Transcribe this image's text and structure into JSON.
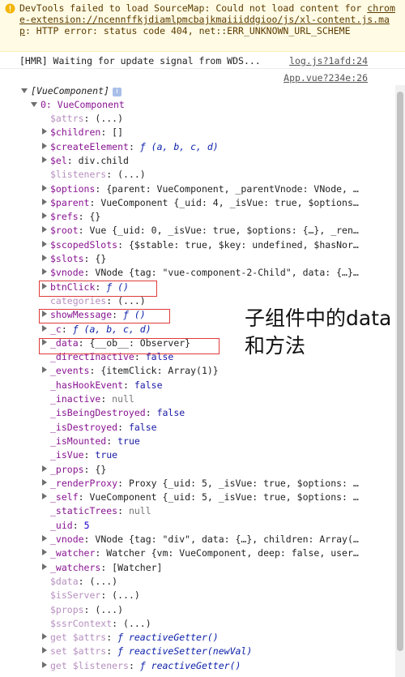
{
  "warning": {
    "icon": "warning-triangle-icon",
    "prefix": "DevTools failed to load SourceMap: Could not load content for ",
    "url": "chrome-extension://ncennffkjdiamlpmcbajkmaiiiddgioo/js/xl-content.js.map",
    "suffix": ": HTTP error: status code 404, net::ERR_UNKNOWN_URL_SCHEME"
  },
  "hmr": {
    "message": "[HMR] Waiting for update signal from WDS...",
    "source": "log.js?1afd:24"
  },
  "log_source": "App.vue?234e:26",
  "tree": {
    "root_label": "[VueComponent]",
    "item_label": "0: VueComponent",
    "props": [
      {
        "key": "$attrs",
        "value": "(...)",
        "expandable": false
      },
      {
        "key": "$children",
        "value": "[]",
        "expandable": true
      },
      {
        "key": "$createElement",
        "value": "ƒ (a, b, c, d)",
        "expandable": true
      },
      {
        "key": "$el",
        "value": "div.child",
        "expandable": true
      },
      {
        "key": "$listeners",
        "value": "(...)",
        "expandable": false
      },
      {
        "key": "$options",
        "value": "{parent: VueComponent, _parentVnode: VNode, …",
        "expandable": true
      },
      {
        "key": "$parent",
        "value": "VueComponent {_uid: 4, _isVue: true, $options…",
        "expandable": true
      },
      {
        "key": "$refs",
        "value": "{}",
        "expandable": true
      },
      {
        "key": "$root",
        "value": "Vue {_uid: 0, _isVue: true, $options: {…}, _ren…",
        "expandable": true
      },
      {
        "key": "$scopedSlots",
        "value": "{$stable: true, $key: undefined, $hasNor…",
        "expandable": true
      },
      {
        "key": "$slots",
        "value": "{}",
        "expandable": true
      },
      {
        "key": "$vnode",
        "value": "VNode {tag: \"vue-component-2-Child\", data: {…}…",
        "expandable": true
      },
      {
        "key": "btnClick",
        "value": "ƒ ()",
        "expandable": true
      },
      {
        "key": "categories",
        "value": "(...)",
        "expandable": false
      },
      {
        "key": "showMessage",
        "value": "ƒ ()",
        "expandable": true
      },
      {
        "key": "_c",
        "value": "ƒ (a, b, c, d)",
        "expandable": true
      },
      {
        "key": "_data",
        "value": "{__ob__: Observer}",
        "expandable": true
      },
      {
        "key": "_directInactive",
        "value": "false",
        "expandable": false
      },
      {
        "key": "_events",
        "value": "{itemClick: Array(1)}",
        "expandable": true
      },
      {
        "key": "_hasHookEvent",
        "value": "false",
        "expandable": false
      },
      {
        "key": "_inactive",
        "value": "null",
        "expandable": false
      },
      {
        "key": "_isBeingDestroyed",
        "value": "false",
        "expandable": false
      },
      {
        "key": "_isDestroyed",
        "value": "false",
        "expandable": false
      },
      {
        "key": "_isMounted",
        "value": "true",
        "expandable": false
      },
      {
        "key": "_isVue",
        "value": "true",
        "expandable": false
      },
      {
        "key": "_props",
        "value": "{}",
        "expandable": true
      },
      {
        "key": "_renderProxy",
        "value": "Proxy {_uid: 5, _isVue: true, $options: …",
        "expandable": true
      },
      {
        "key": "_self",
        "value": "VueComponent {_uid: 5, _isVue: true, $options: …",
        "expandable": true
      },
      {
        "key": "_staticTrees",
        "value": "null",
        "expandable": false
      },
      {
        "key": "_uid",
        "value": "5",
        "expandable": false
      },
      {
        "key": "_vnode",
        "value": "VNode {tag: \"div\", data: {…}, children: Array(…",
        "expandable": true
      },
      {
        "key": "_watcher",
        "value": "Watcher {vm: VueComponent, deep: false, user…",
        "expandable": true
      },
      {
        "key": "_watchers",
        "value": "[Watcher]",
        "expandable": true
      },
      {
        "key": "$data",
        "value": "(...)",
        "expandable": false
      },
      {
        "key": "$isServer",
        "value": "(...)",
        "expandable": false
      },
      {
        "key": "$props",
        "value": "(...)",
        "expandable": false
      },
      {
        "key": "$ssrContext",
        "value": "(...)",
        "expandable": false
      },
      {
        "key": "get $attrs",
        "value": "ƒ reactiveGetter()",
        "expandable": true
      },
      {
        "key": "set $attrs",
        "value": "ƒ reactiveSetter(newVal)",
        "expandable": true
      },
      {
        "key": "get $listeners",
        "value": "ƒ reactiveGetter()",
        "expandable": true
      }
    ]
  },
  "annotation": {
    "line1": "子组件中的data",
    "line2": "和方法"
  },
  "colors": {
    "highlight_box": "#e03a3a",
    "warning_bg": "#fffbe5",
    "property_key": "#881391"
  }
}
